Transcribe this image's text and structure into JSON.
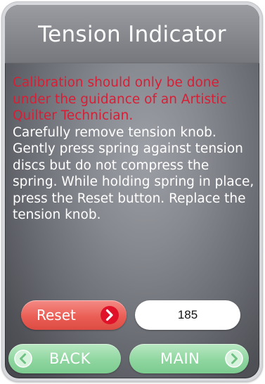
{
  "header": {
    "title": "Tension Indicator"
  },
  "content": {
    "warning": "Calibration should only be done under the guidance of an Artistic Quilter Technician.",
    "instructions": "Carefully remove tension knob. Gently press spring against tension discs but do not compress the spring. While holding spring in place, press the Reset button. Replace the tension knob."
  },
  "controls": {
    "reset_label": "Reset",
    "tension_value": "185"
  },
  "nav": {
    "back_label": "BACK",
    "main_label": "MAIN"
  },
  "colors": {
    "warning_text": "#d71e35",
    "reset_button": "#ea5f56",
    "nav_button": "#8fd6a0",
    "screen_background": "#878990"
  },
  "icons": {
    "reset": "chevron-right-circle-icon",
    "back": "chevron-left-circle-icon",
    "main": "chevron-right-circle-icon"
  }
}
